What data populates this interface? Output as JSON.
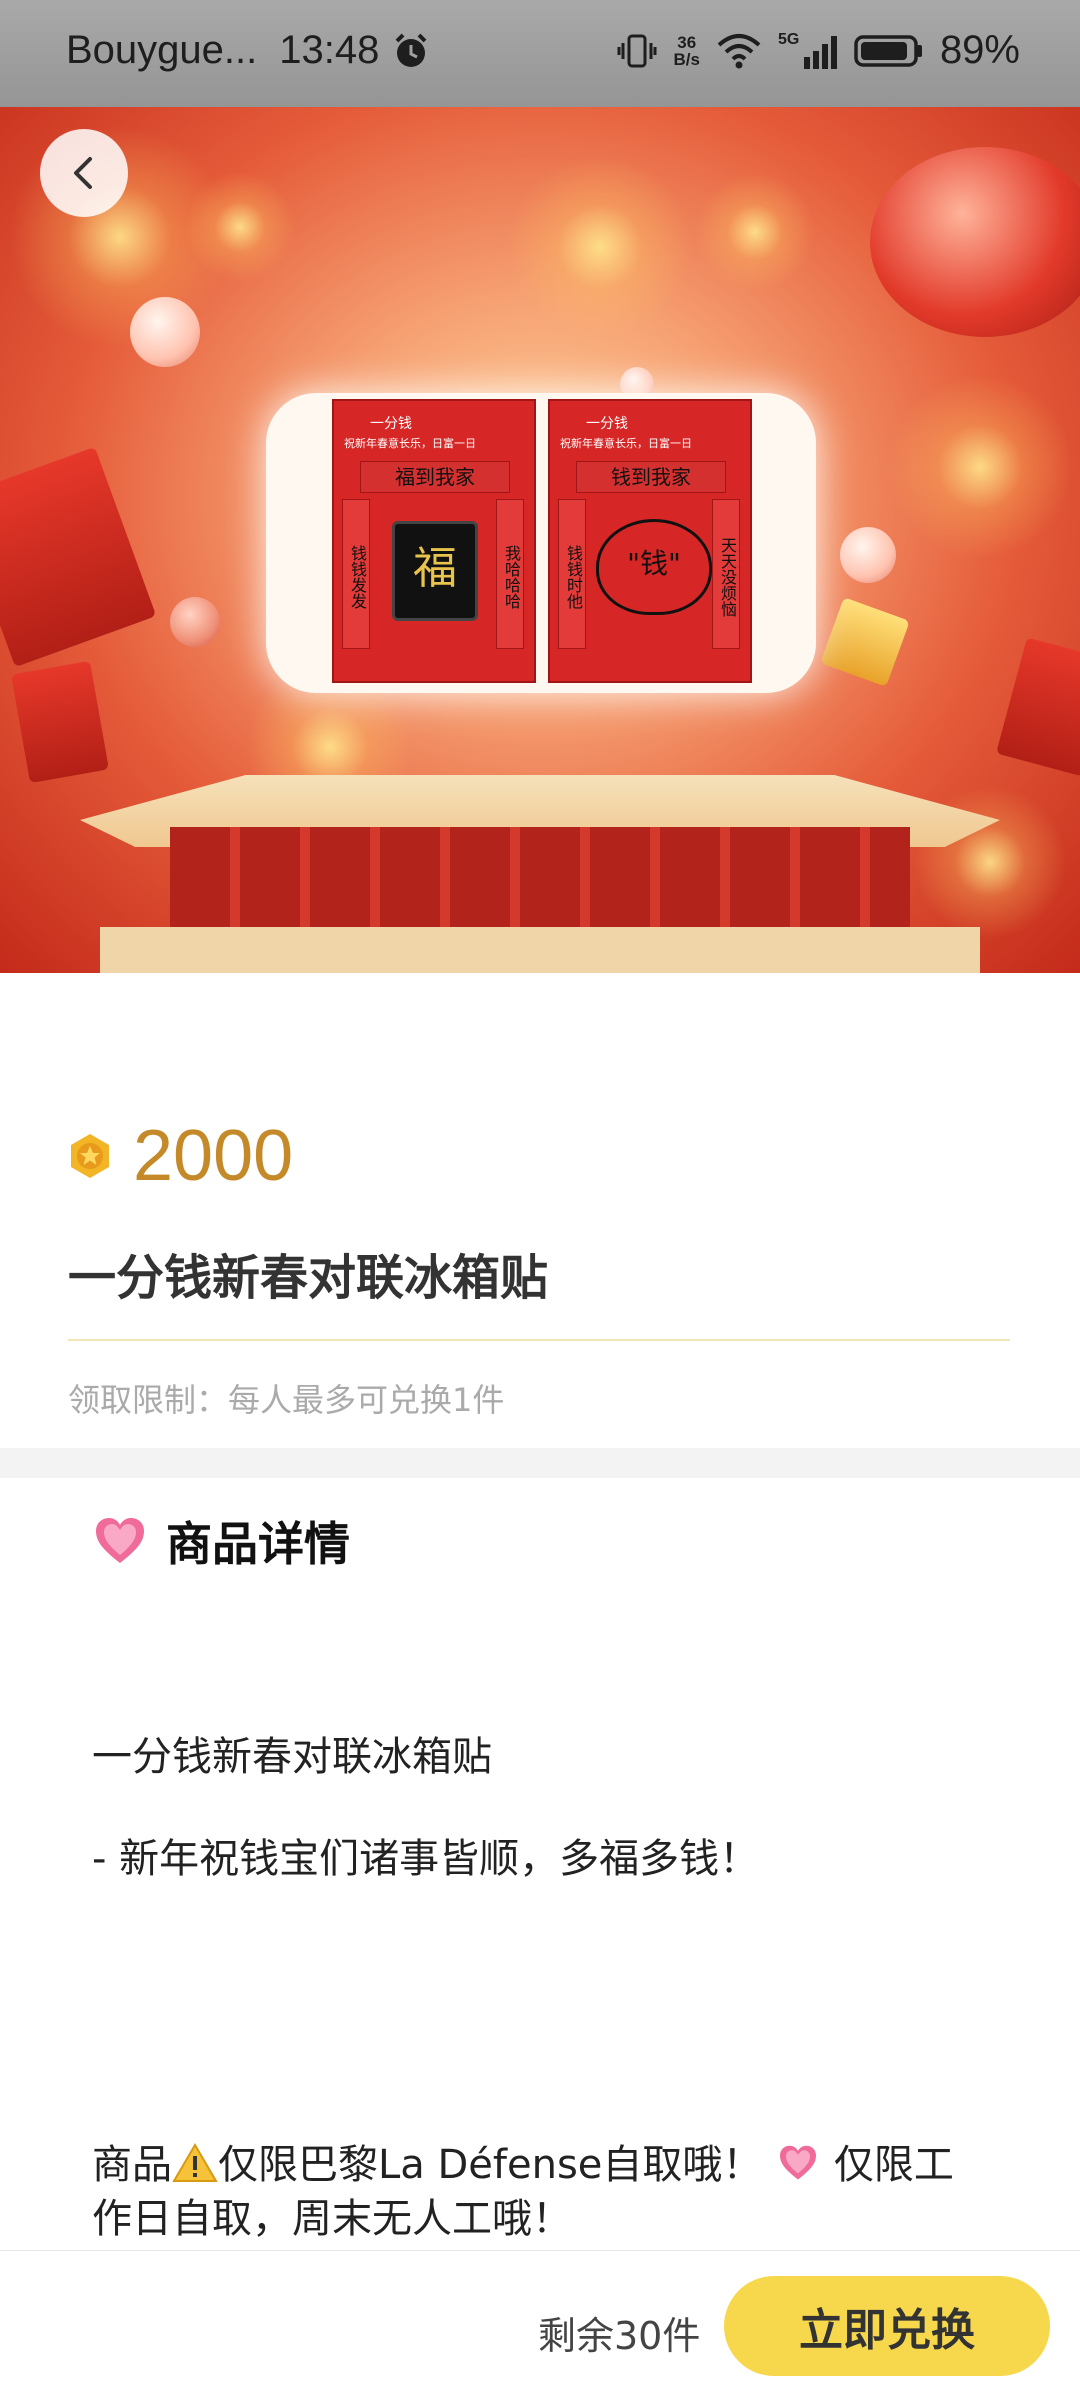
{
  "status_bar": {
    "carrier": "Bouygue...",
    "time": "13:48",
    "speed_top": "36",
    "speed_bottom": "B/s",
    "network": "5G",
    "battery": "89%"
  },
  "banner": {
    "sticker_left": {
      "brand": "一分钱",
      "slogan": "祝新年春意长乐，日富一日",
      "header": "福到我家",
      "left_couplet": "钱钱发发",
      "right_couplet": "我哈哈哈",
      "center": "福"
    },
    "sticker_right": {
      "brand": "一分钱",
      "slogan": "祝新年春意长乐，日富一日",
      "header": "钱到我家",
      "left_couplet": "钱钱时他",
      "right_couplet": "天天没烦恼",
      "center": "\"钱\""
    }
  },
  "product": {
    "price": "2000",
    "title": "一分钱新春对联冰箱贴",
    "limit": "领取限制：每人最多可兑换1件"
  },
  "details": {
    "section_title": "商品详情",
    "line1": "一分钱新春对联冰箱贴",
    "line2": "- 新年祝钱宝们诸事皆顺，多福多钱！",
    "note_part1": "商品",
    "note_part2": "仅限巴黎La Défense自取哦！",
    "note_part3": "仅限工作日自取，周末无人工哦！"
  },
  "footer": {
    "remaining": "剩余30件",
    "redeem_label": "立即兑换"
  },
  "colors": {
    "accent_yellow": "#f7d84c",
    "price_gold": "#c48a2a"
  }
}
